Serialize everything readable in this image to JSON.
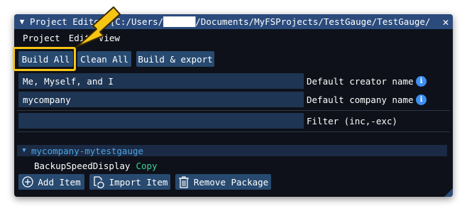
{
  "window": {
    "title": "Project Editor [C:/Users/██████/Documents/MyFSProjects/TestGauge/TestGauge/",
    "collapse_glyph": "▼",
    "close_glyph": "✕"
  },
  "menu": {
    "items": [
      "Project",
      "Edit",
      "View"
    ]
  },
  "toolbar": {
    "build_all": "Build All",
    "clean_all": "Clean All",
    "build_export": "Build & export"
  },
  "fields": {
    "creator_value": "Me, Myself, and I",
    "creator_label": "Default creator name",
    "company_value": "mycompany",
    "company_label": "Default company name",
    "filter_value": "",
    "filter_label": "Filter (inc,-exc)",
    "info_glyph": "i"
  },
  "tree": {
    "package_name": "mycompany-mytestgauge",
    "expand_glyph": "▼",
    "item_name": "BackupSpeedDisplay",
    "item_status": "Copy"
  },
  "footer": {
    "add_item": "Add Item",
    "import_item": "Import Item",
    "remove_package": "Remove Package"
  },
  "annotation": {
    "color": "#f6c514"
  }
}
